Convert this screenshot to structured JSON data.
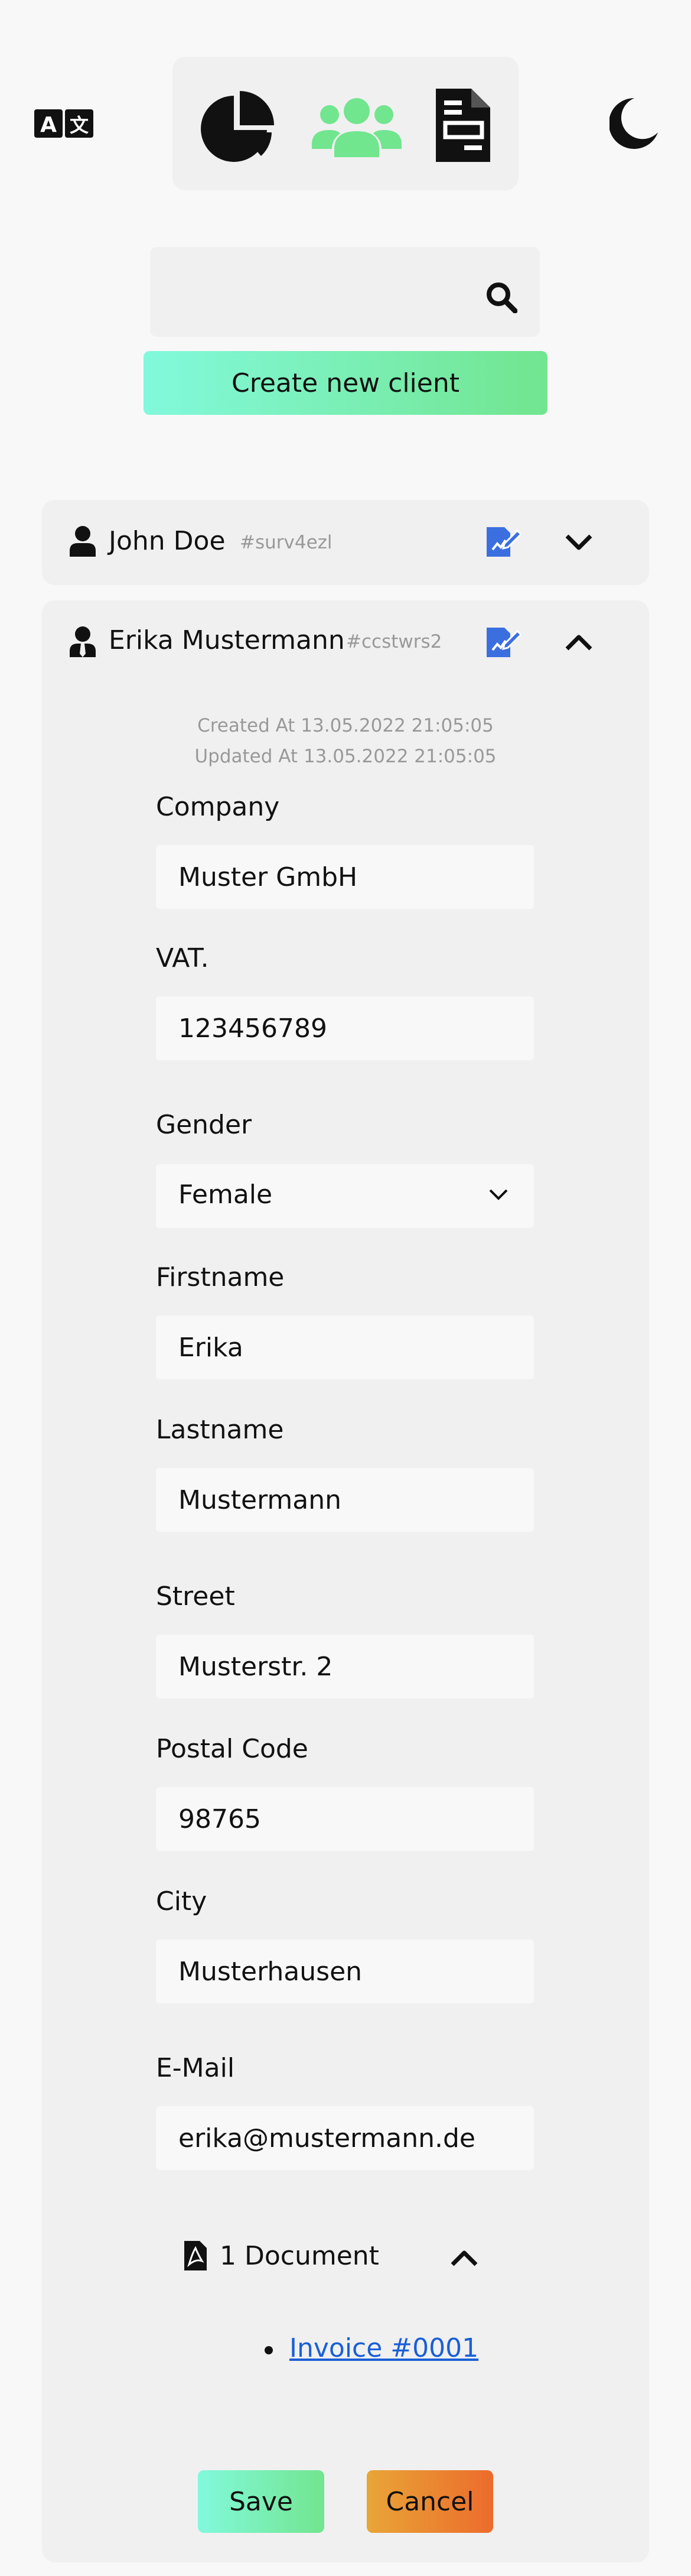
{
  "header": {
    "icons": [
      "translate-icon",
      "pie-chart-icon",
      "users-icon",
      "document-icon",
      "moon-icon"
    ],
    "active_nav": "users"
  },
  "search": {
    "value": "",
    "placeholder": ""
  },
  "create_button": "Create new client",
  "clients": [
    {
      "name": "John Doe",
      "id": "#surv4ezl"
    },
    {
      "name": "Erika Mustermann",
      "id": "#ccstwrs2"
    }
  ],
  "detail": {
    "created": "Created At 13.05.2022 21:05:05",
    "updated": "Updated At 13.05.2022 21:05:05",
    "company_label": "Company",
    "company_value": "Muster GmbH",
    "vat_label": "VAT.",
    "vat_value": "123456789",
    "gender_label": "Gender",
    "gender_value": "Female",
    "firstname_label": "Firstname",
    "firstname_value": "Erika",
    "lastname_label": "Lastname",
    "lastname_value": "Mustermann",
    "street_label": "Street",
    "street_value": "Musterstr. 2",
    "postal_label": "Postal Code",
    "postal_value": "98765",
    "city_label": "City",
    "city_value": "Musterhausen",
    "email_label": "E-Mail",
    "email_value": "erika@mustermann.de",
    "documents_label": "1 Document",
    "documents": [
      "Invoice #0001"
    ],
    "save": "Save",
    "cancel": "Cancel"
  },
  "colors": {
    "accent_green": "#72e58f",
    "gradient_green_start": "#82f9dc",
    "cancel_orange": "#ec6c2c",
    "edit_blue": "#3b6fe0",
    "link_blue": "#1a5fd6"
  }
}
